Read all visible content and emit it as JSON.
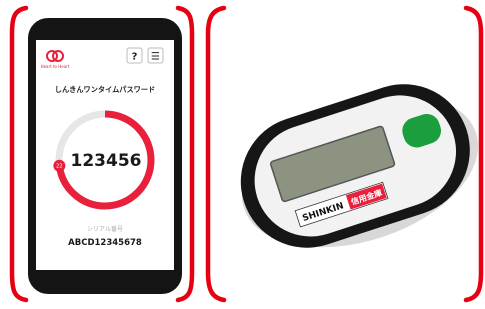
{
  "phone": {
    "app_logo": {
      "icon": "heart-logo-icon",
      "label": "Heart to Heart"
    },
    "help_button": "?",
    "menu_button": "☰",
    "title": "しんきんワンタイムパスワード",
    "otp_code": "123456",
    "countdown_seconds": "22",
    "timer_progress_fraction": 0.73,
    "serial_label": "シリアル番号",
    "serial_number": "ABCD12345678"
  },
  "token": {
    "brand": "SHINKIN",
    "bank_name": "信用金庫",
    "button_color": "#1a9e3e"
  },
  "colors": {
    "bracket_red": "#e60012",
    "accent_red": "#e8203c"
  }
}
